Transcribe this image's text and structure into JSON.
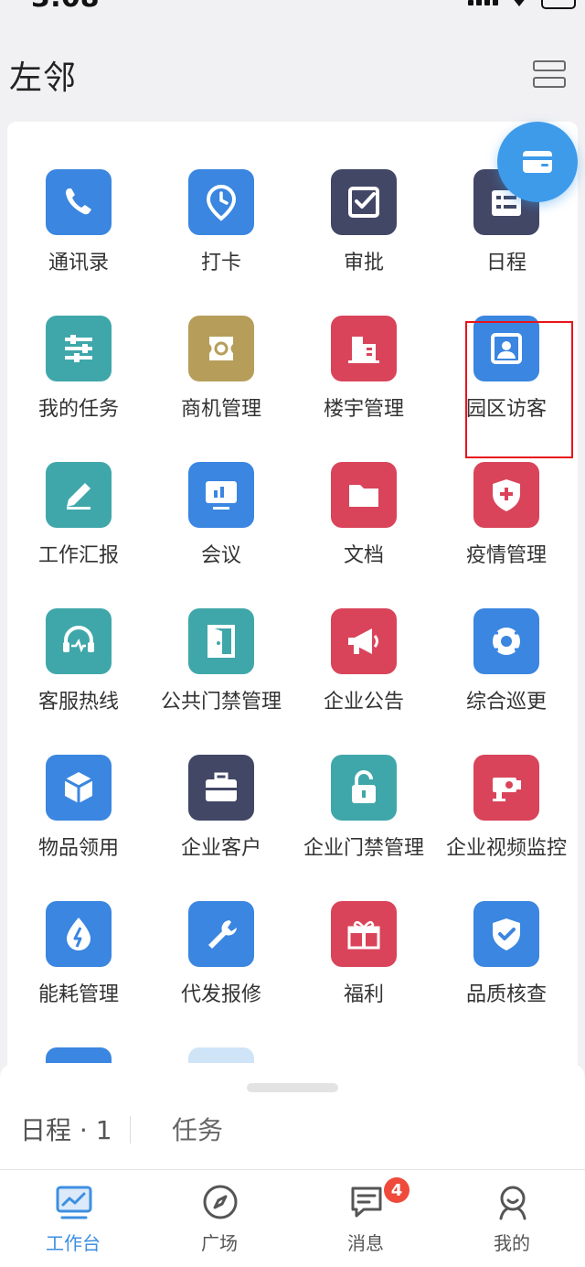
{
  "status_bar": {
    "time": "3:08"
  },
  "header": {
    "title": "左邻"
  },
  "apps": [
    {
      "label": "通讯录",
      "icon": "phone-icon",
      "color": "#3a86e0"
    },
    {
      "label": "打卡",
      "icon": "location-clock-icon",
      "color": "#3a86e0"
    },
    {
      "label": "审批",
      "icon": "approve-icon",
      "color": "#424766"
    },
    {
      "label": "日程",
      "icon": "calendar-list-icon",
      "color": "#424766"
    },
    {
      "label": "我的任务",
      "icon": "task-sliders-icon",
      "color": "#3fa7aa"
    },
    {
      "label": "商机管理",
      "icon": "business-coin-icon",
      "color": "#b69e5a"
    },
    {
      "label": "楼宇管理",
      "icon": "building-icon",
      "color": "#d9445a"
    },
    {
      "label": "园区访客",
      "icon": "visitor-badge-icon",
      "color": "#3a86e0"
    },
    {
      "label": "工作汇报",
      "icon": "report-pencil-icon",
      "color": "#3fa7aa"
    },
    {
      "label": "会议",
      "icon": "meeting-screen-icon",
      "color": "#3a86e0"
    },
    {
      "label": "文档",
      "icon": "folder-icon",
      "color": "#d9445a"
    },
    {
      "label": "疫情管理",
      "icon": "medical-shield-icon",
      "color": "#d9445a"
    },
    {
      "label": "客服热线",
      "icon": "headset-icon",
      "color": "#3fa7aa"
    },
    {
      "label": "公共门禁管理",
      "icon": "door-icon",
      "color": "#3fa7aa"
    },
    {
      "label": "企业公告",
      "icon": "megaphone-icon",
      "color": "#d9445a"
    },
    {
      "label": "综合巡更",
      "icon": "patrol-camera-icon",
      "color": "#3a86e0"
    },
    {
      "label": "物品领用",
      "icon": "box-icon",
      "color": "#3a86e0"
    },
    {
      "label": "企业客户",
      "icon": "briefcase-icon",
      "color": "#424766"
    },
    {
      "label": "企业门禁管理",
      "icon": "unlock-icon",
      "color": "#3fa7aa"
    },
    {
      "label": "企业视频监控",
      "icon": "video-camera-icon",
      "color": "#d9445a"
    },
    {
      "label": "能耗管理",
      "icon": "energy-drop-icon",
      "color": "#3a86e0"
    },
    {
      "label": "代发报修",
      "icon": "wrench-icon",
      "color": "#3a86e0"
    },
    {
      "label": "福利",
      "icon": "gift-icon",
      "color": "#d9445a"
    },
    {
      "label": "品质核查",
      "icon": "quality-shield-icon",
      "color": "#3a86e0"
    }
  ],
  "sheet": {
    "schedule_tab": "日程 · 1",
    "tasks_tab": "任务"
  },
  "nav": {
    "items": [
      {
        "label": "工作台",
        "icon": "workbench-icon"
      },
      {
        "label": "广场",
        "icon": "compass-icon"
      },
      {
        "label": "消息",
        "icon": "message-icon"
      },
      {
        "label": "我的",
        "icon": "profile-icon"
      }
    ],
    "message_badge": "4"
  },
  "colors": {
    "accent": "#3d8fe0",
    "badge": "#ef4a3b"
  }
}
